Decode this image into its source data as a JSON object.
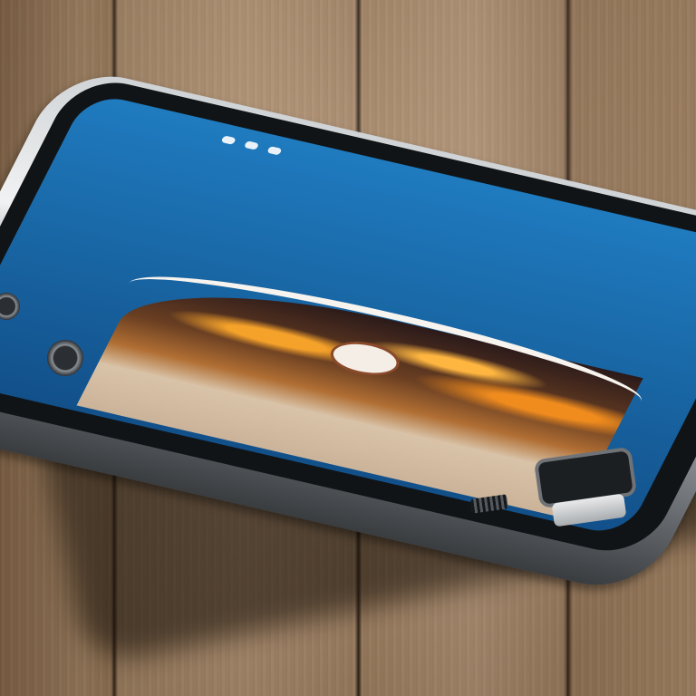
{
  "scene": {
    "phone_screen": {
      "header_title": "",
      "header_text": "",
      "hero_number": "",
      "hero_caption": "",
      "cta_label": ""
    },
    "icons": [
      "signal-icon",
      "wifi-icon",
      "battery-icon"
    ]
  }
}
